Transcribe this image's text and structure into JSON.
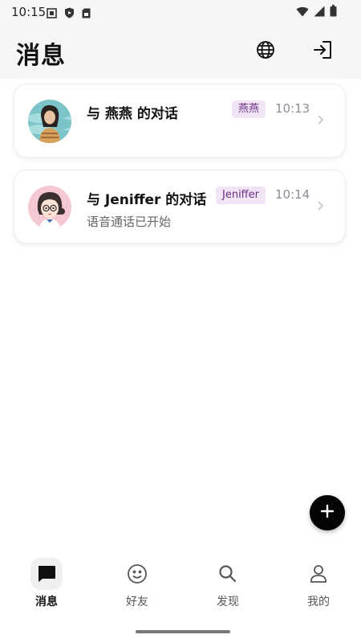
{
  "status_bar": {
    "time": "10:15",
    "left_icons": [
      "screen-record-icon",
      "shield-icon",
      "sim-card-icon"
    ],
    "right_icons": [
      "wifi-icon",
      "signal-icon",
      "battery-icon"
    ]
  },
  "header": {
    "title": "消息",
    "actions": [
      "globe-icon",
      "logout-icon"
    ]
  },
  "chats": [
    {
      "title": "与 燕燕 的对话",
      "tag": "燕燕",
      "time": "10:13",
      "subtitle": ""
    },
    {
      "title": "与 Jeniffer 的对话",
      "tag": "Jeniffer",
      "time": "10:14",
      "subtitle": "语音通话已开始"
    }
  ],
  "fab": {
    "icon": "plus-icon"
  },
  "tabs": [
    {
      "label": "消息",
      "icon": "chat-bubble-icon",
      "active": true
    },
    {
      "label": "好友",
      "icon": "smiley-icon",
      "active": false
    },
    {
      "label": "发现",
      "icon": "search-icon",
      "active": false
    },
    {
      "label": "我的",
      "icon": "person-icon",
      "active": false
    }
  ],
  "colors": {
    "header_bg": "#f5f6f8",
    "tag_bg": "#f1e4f6",
    "tag_text": "#6b2f82",
    "fab_bg": "#050505"
  }
}
